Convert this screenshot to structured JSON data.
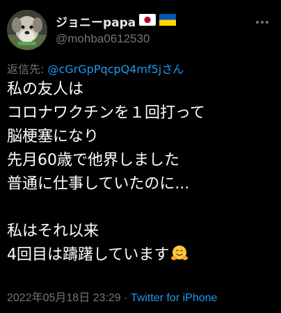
{
  "author": {
    "display_name": "ジョニーpapa",
    "flags": [
      "japan-flag",
      "ukraine-flag"
    ],
    "handle": "@mohba0612530",
    "avatar": "dog-avatar-photo"
  },
  "reply": {
    "prefix": "返信先: ",
    "target": "@cGrGpPqcpQ4mf5jさん"
  },
  "tweet": {
    "lines": [
      "私の友人は",
      "コロナワクチンを１回打って",
      "脳梗塞になり",
      "先月60歳で他界しました",
      "普通に仕事していたのに...",
      "",
      "私はそれ以来",
      "4回目は躊躇しています"
    ],
    "trailing_emoji": "hugging-face-emoji"
  },
  "meta": {
    "timestamp": "2022年05月18日 23:29",
    "separator": " · ",
    "client": "Twitter for iPhone"
  },
  "colors": {
    "background": "#000000",
    "text": "#ffffff",
    "secondary": "#71767b",
    "link": "#1d9bf0"
  }
}
